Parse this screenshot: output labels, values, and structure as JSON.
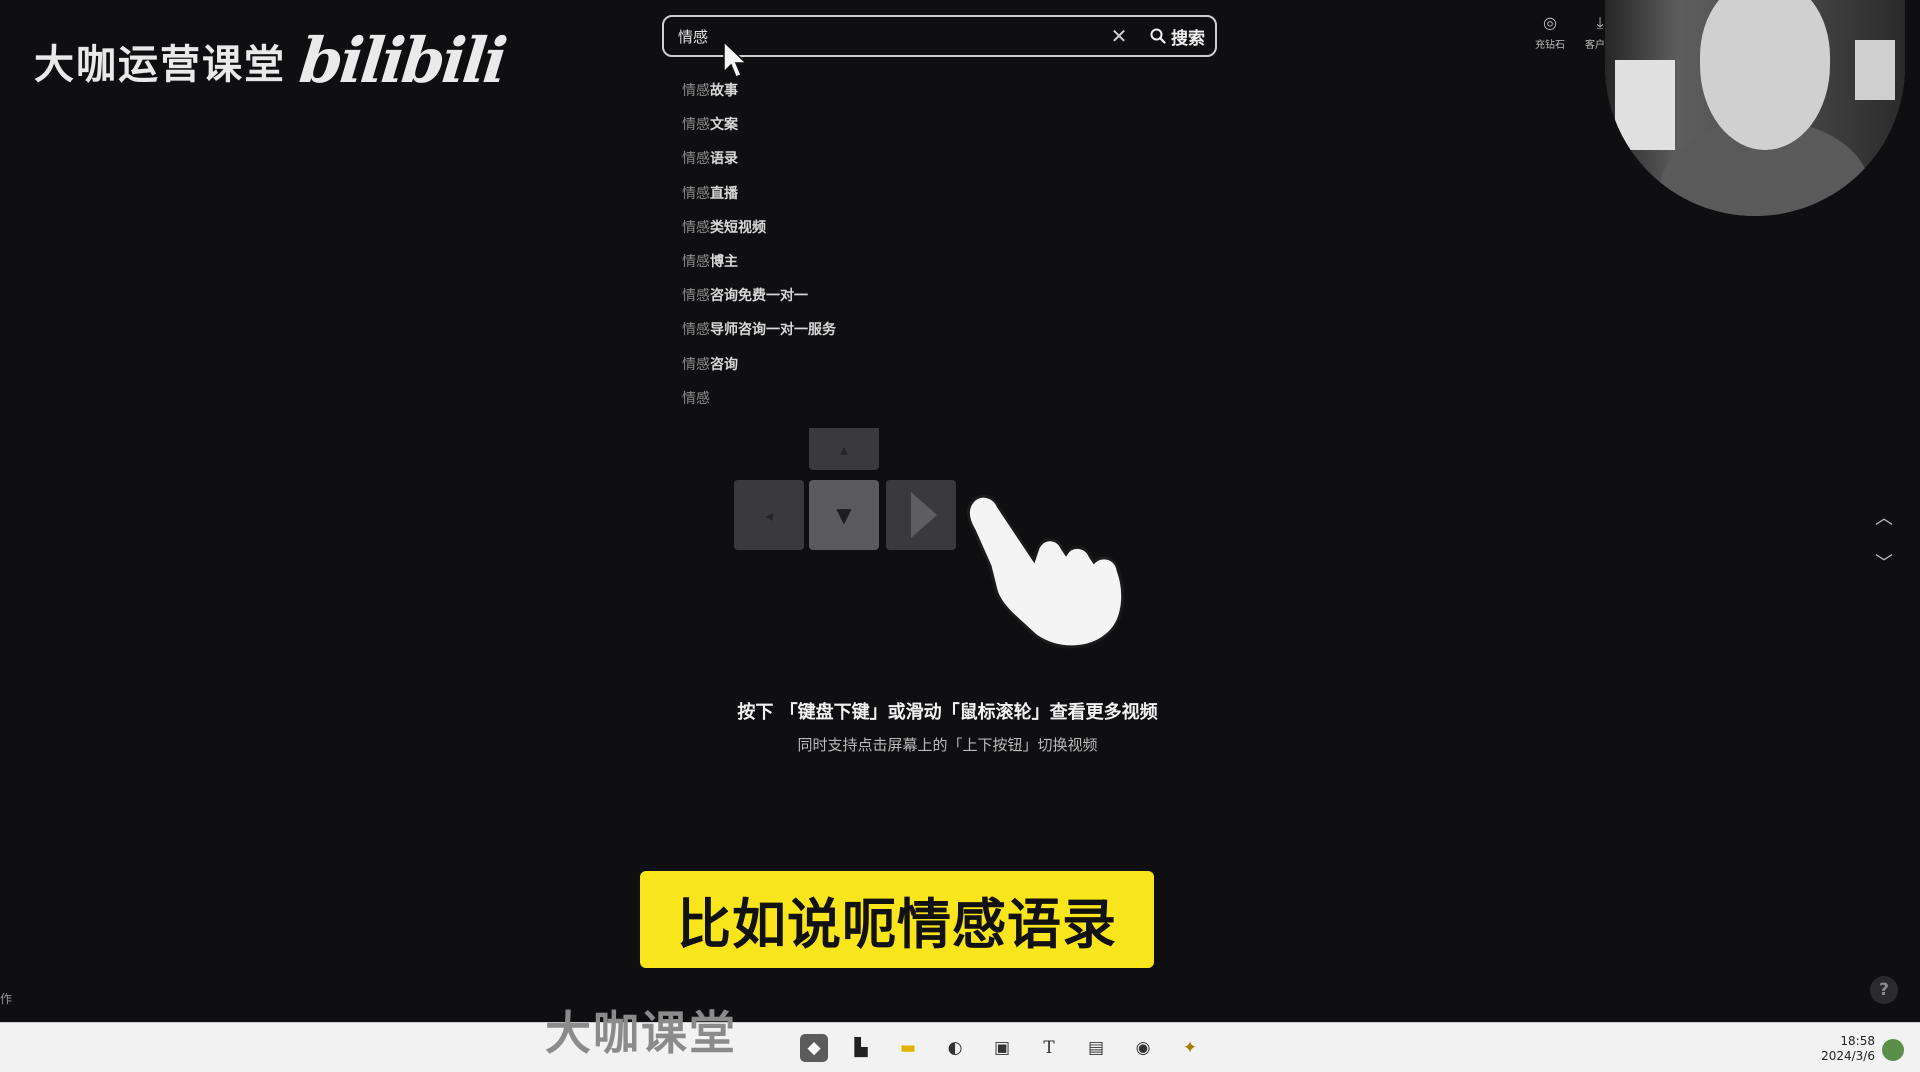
{
  "watermark": {
    "text": "大咖运营课堂",
    "brand": "bilibili"
  },
  "search": {
    "value": "情感",
    "clear_icon": "close-icon",
    "button_label": "搜索"
  },
  "suggestions": [
    {
      "kw": "情感",
      "rest": "故事"
    },
    {
      "kw": "情感",
      "rest": "文案"
    },
    {
      "kw": "情感",
      "rest": "语录"
    },
    {
      "kw": "情感",
      "rest": "直播"
    },
    {
      "kw": "情感",
      "rest": "类短视频"
    },
    {
      "kw": "情感",
      "rest": "博主"
    },
    {
      "kw": "情感",
      "rest": "咨询免费一对一"
    },
    {
      "kw": "情感",
      "rest": "导师咨询一对一服务"
    },
    {
      "kw": "情感",
      "rest": "咨询"
    },
    {
      "kw": "情感",
      "rest": ""
    }
  ],
  "hint": {
    "main": "按下 「键盘下键」或滑动「鼠标滚轮」查看更多视频",
    "sub": "同时支持点击屏幕上的「上下按钮」切换视频"
  },
  "caption": "比如说呃情感语录",
  "top_icons": [
    {
      "icon": "diamond-icon",
      "label": "充钻石"
    },
    {
      "icon": "download-icon",
      "label": "客户端"
    }
  ],
  "left_edge_text": "作",
  "taskbar": {
    "watermark": "大咖课堂",
    "clock_time": "18:58",
    "clock_date": "2024/3/6"
  },
  "colors": {
    "background": "#0f0f11",
    "caption_bg": "#f8e51b",
    "taskbar_bg": "#f2f2f2"
  }
}
